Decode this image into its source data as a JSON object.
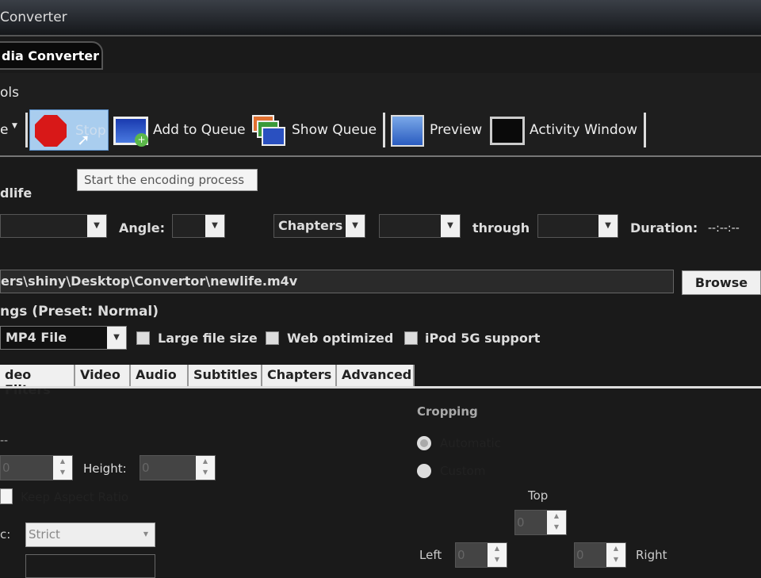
{
  "window": {
    "title": "Converter",
    "app_tab": "dia Converter",
    "tools_label": "ols"
  },
  "toolbar": {
    "partial_item": "e",
    "stop": "Stop",
    "add_queue": "Add to Queue",
    "show_queue": "Show Queue",
    "preview": "Preview",
    "activity": "Activity Window",
    "tooltip": "Start the encoding process"
  },
  "source": {
    "title": "dlife",
    "angle_label": "Angle:",
    "chapters": "Chapters",
    "through": "through",
    "duration_label": "Duration:",
    "duration": "--:--:--"
  },
  "destination": {
    "path": "ers\\shiny\\Desktop\\Convertor\\newlife.m4v",
    "browse": "Browse"
  },
  "output": {
    "label": "ngs (Preset: Normal)",
    "container": "MP4 File",
    "large_file": "Large file size",
    "web_opt": "Web optimized",
    "ipod": "iPod 5G support"
  },
  "tabs": [
    "deo Filters",
    "Video",
    "Audio",
    "Subtitles",
    "Chapters",
    "Advanced"
  ],
  "picture": {
    "dash": "--",
    "width_value": "0",
    "height_label": "Height:",
    "height_value": "0",
    "keep_aspect": "Keep Aspect Ratio",
    "anamorphic_label": "c:",
    "anamorphic": "Strict"
  },
  "cropping": {
    "label": "Cropping",
    "automatic": "Automatic",
    "custom": "Custom",
    "top": "Top",
    "left": "Left",
    "right": "Right",
    "top_value": "0",
    "left_value": "0",
    "right_value": "0"
  }
}
